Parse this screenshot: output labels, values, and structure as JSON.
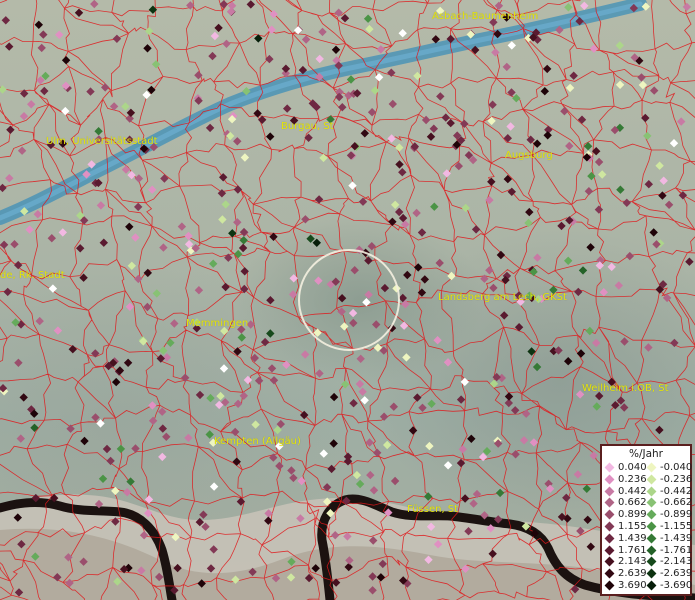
{
  "legend": {
    "title": "%/Jahr",
    "positive": [
      {
        "value": "0.040",
        "color": "#f2b8e2"
      },
      {
        "value": "0.236",
        "color": "#e090c2"
      },
      {
        "value": "0.442",
        "color": "#c87aa4"
      },
      {
        "value": "0.662",
        "color": "#b06486"
      },
      {
        "value": "0.899",
        "color": "#9a4e6c"
      },
      {
        "value": "1.155",
        "color": "#833956"
      },
      {
        "value": "1.439",
        "color": "#6e2842"
      },
      {
        "value": "1.761",
        "color": "#5a1a30"
      },
      {
        "value": "2.143",
        "color": "#46101f"
      },
      {
        "value": "2.639",
        "color": "#310812"
      },
      {
        "value": "3.690",
        "color": "#1e0308"
      }
    ],
    "negative": [
      {
        "value": "-0.040",
        "color": "#eef5c0"
      },
      {
        "value": "-0.236",
        "color": "#cfe7a0"
      },
      {
        "value": "-0.442",
        "color": "#acd68a"
      },
      {
        "value": "-0.662",
        "color": "#88c274"
      },
      {
        "value": "-0.899",
        "color": "#65ab5b"
      },
      {
        "value": "-1.155",
        "color": "#4b9446"
      },
      {
        "value": "-1.439",
        "color": "#357a36"
      },
      {
        "value": "-1.761",
        "color": "#246228"
      },
      {
        "value": "-2.143",
        "color": "#174a1c"
      },
      {
        "value": "-2.639",
        "color": "#0d3311"
      },
      {
        "value": "-3.690",
        "color": "#061e09"
      }
    ]
  },
  "cities": [
    {
      "name": "Asbach-Baumenheim"
    },
    {
      "name": "Burgau, St"
    },
    {
      "name": "Ulm, Universitätsstadt"
    },
    {
      "name": "Augsburg"
    },
    {
      "name": "Landsberg am Lech, GKSt"
    },
    {
      "name": "Memmingen"
    },
    {
      "name": "Weilheim i.OB, St"
    },
    {
      "name": "Kempten (Allgäu)"
    },
    {
      "name": "Füssen, St"
    },
    {
      "name": "de, Rk. Stadt"
    }
  ],
  "colors": {
    "boundary": "#e0161a",
    "river": "#3d8fb8",
    "city_label": "#e6e60a",
    "frontier": "#1b1210",
    "selection_circle": "#f4f0e0"
  }
}
